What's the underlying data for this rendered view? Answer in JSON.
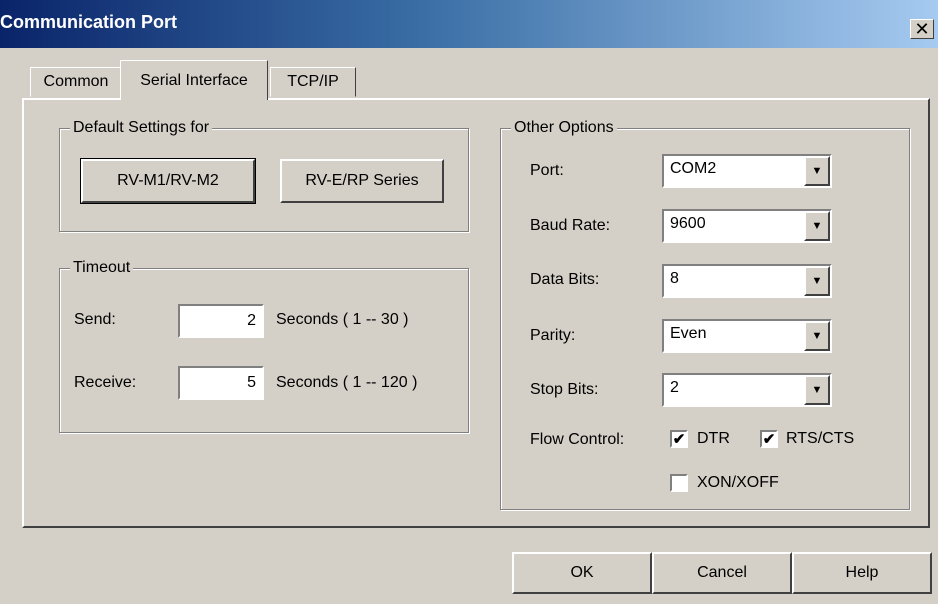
{
  "window": {
    "title": "Communication Port",
    "close_glyph": "✕"
  },
  "tabs": [
    {
      "label": "Common",
      "active": false
    },
    {
      "label": "Serial Interface",
      "active": true
    },
    {
      "label": "TCP/IP",
      "active": false
    }
  ],
  "default_settings": {
    "legend": "Default Settings for",
    "buttons": [
      "RV-M1/RV-M2",
      "RV-E/RP Series"
    ]
  },
  "timeout": {
    "legend": "Timeout",
    "send": {
      "label": "Send:",
      "value": "2",
      "range": "Seconds ( 1 -- 30 )"
    },
    "receive": {
      "label": "Receive:",
      "value": "5",
      "range": "Seconds ( 1 -- 120 )"
    }
  },
  "other_options": {
    "legend": "Other Options",
    "port": {
      "label": "Port:",
      "value": "COM2"
    },
    "baud_rate": {
      "label": "Baud Rate:",
      "value": "9600"
    },
    "data_bits": {
      "label": "Data Bits:",
      "value": "8"
    },
    "parity": {
      "label": "Parity:",
      "value": "Even"
    },
    "stop_bits": {
      "label": "Stop Bits:",
      "value": "2"
    },
    "flow_control": {
      "label": "Flow Control:",
      "dtr": {
        "label": "DTR",
        "checked": true
      },
      "rts_cts": {
        "label": "RTS/CTS",
        "checked": true
      },
      "xon_xoff": {
        "label": "XON/XOFF",
        "checked": false
      }
    }
  },
  "footer": {
    "ok": "OK",
    "cancel": "Cancel",
    "help": "Help"
  },
  "icons": {
    "check": "✔",
    "dropdown": "▼"
  },
  "colors": {
    "face": "#d4d0c8",
    "title_start": "#0a246a",
    "title_end": "#a6caf0"
  }
}
